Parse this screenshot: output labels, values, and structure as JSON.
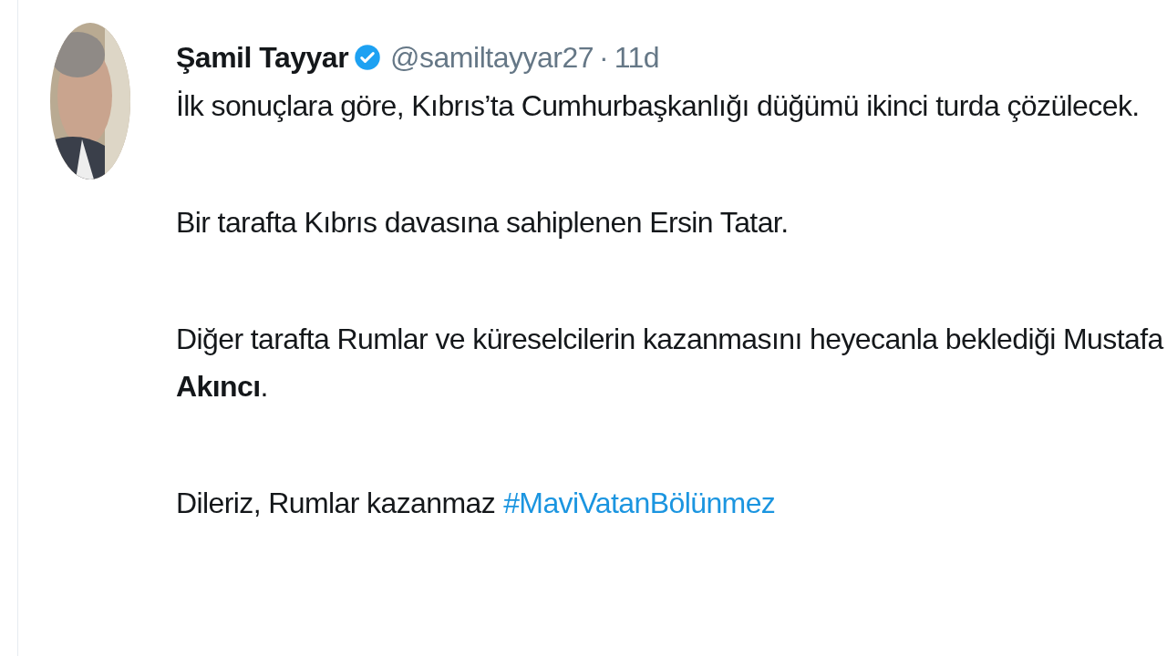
{
  "tweet": {
    "author": {
      "name": "Şamil Tayyar",
      "verified": true,
      "handle": "@samiltayyar27",
      "separator": "·",
      "time": "11d"
    },
    "paragraphs": [
      {
        "text": "İlk sonuçlara göre, Kıbrıs’ta Cumhurbaşkanlığı düğümü ikinci turda çözülecek."
      },
      {
        "text": "Bir tarafta Kıbrıs davasına sahiplenen Ersin Tatar."
      },
      {
        "text": "Diğer tarafta Rumlar ve küreselcilerin kazanmasını heyecanla beklediği Mustafa **Akıncı**."
      },
      {
        "text": "Dileriz, Rumlar kazanmaz",
        "hashtag": "#MaviVatanBölünmez"
      }
    ]
  }
}
